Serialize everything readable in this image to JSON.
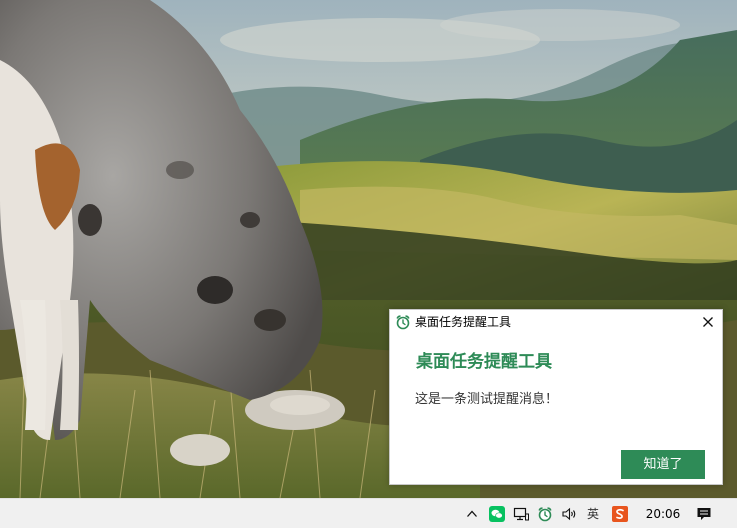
{
  "notification": {
    "app_title": "桌面任务提醒工具",
    "heading": "桌面任务提醒工具",
    "message": "这是一条测试提醒消息！",
    "ok_label": "知道了"
  },
  "taskbar": {
    "ime_label": "英",
    "clock": "20:06"
  },
  "icons": [
    "dog-landscape-wallpaper",
    "alarm-clock-icon",
    "close-icon",
    "chevron-up-icon",
    "wechat-icon",
    "network-icon",
    "alarm-clock-icon",
    "volume-icon",
    "ime-icon",
    "sogou-input-icon",
    "notification-center-icon"
  ],
  "colors": {
    "accent": "#2e8b57",
    "taskbar": "#f0f0f0",
    "wechat": "#07c160",
    "sogou": "#e8551e"
  }
}
